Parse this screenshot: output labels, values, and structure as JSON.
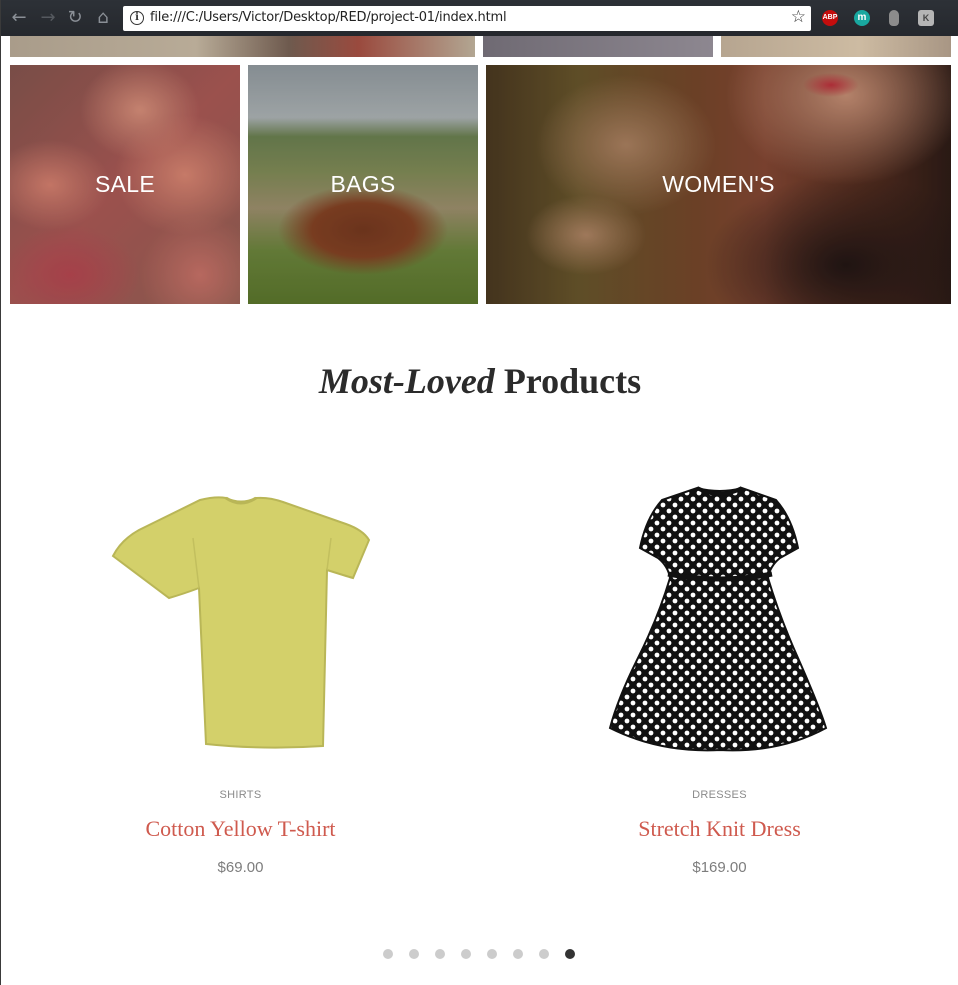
{
  "browser": {
    "url": "file:///C:/Users/Victor/Desktop/RED/project-01/index.html",
    "extensions": [
      "ABP",
      "m",
      "",
      "K"
    ]
  },
  "categories": [
    {
      "label": "SALE"
    },
    {
      "label": "BAGS"
    },
    {
      "label": "WOMEN'S"
    }
  ],
  "section": {
    "title_italic": "Most-Loved",
    "title_bold": "Products"
  },
  "products": [
    {
      "category": "SHIRTS",
      "name": "Cotton Yellow T-shirt",
      "price": "$69.00",
      "color": "#d3d06a"
    },
    {
      "category": "DRESSES",
      "name": "Stretch Knit Dress",
      "price": "$169.00",
      "color": "#111111"
    }
  ],
  "carousel": {
    "total": 8,
    "active": 8
  },
  "colors": {
    "accent": "#cf5a4e",
    "muted": "#8a8a8a",
    "heading": "#2b2b2b"
  }
}
